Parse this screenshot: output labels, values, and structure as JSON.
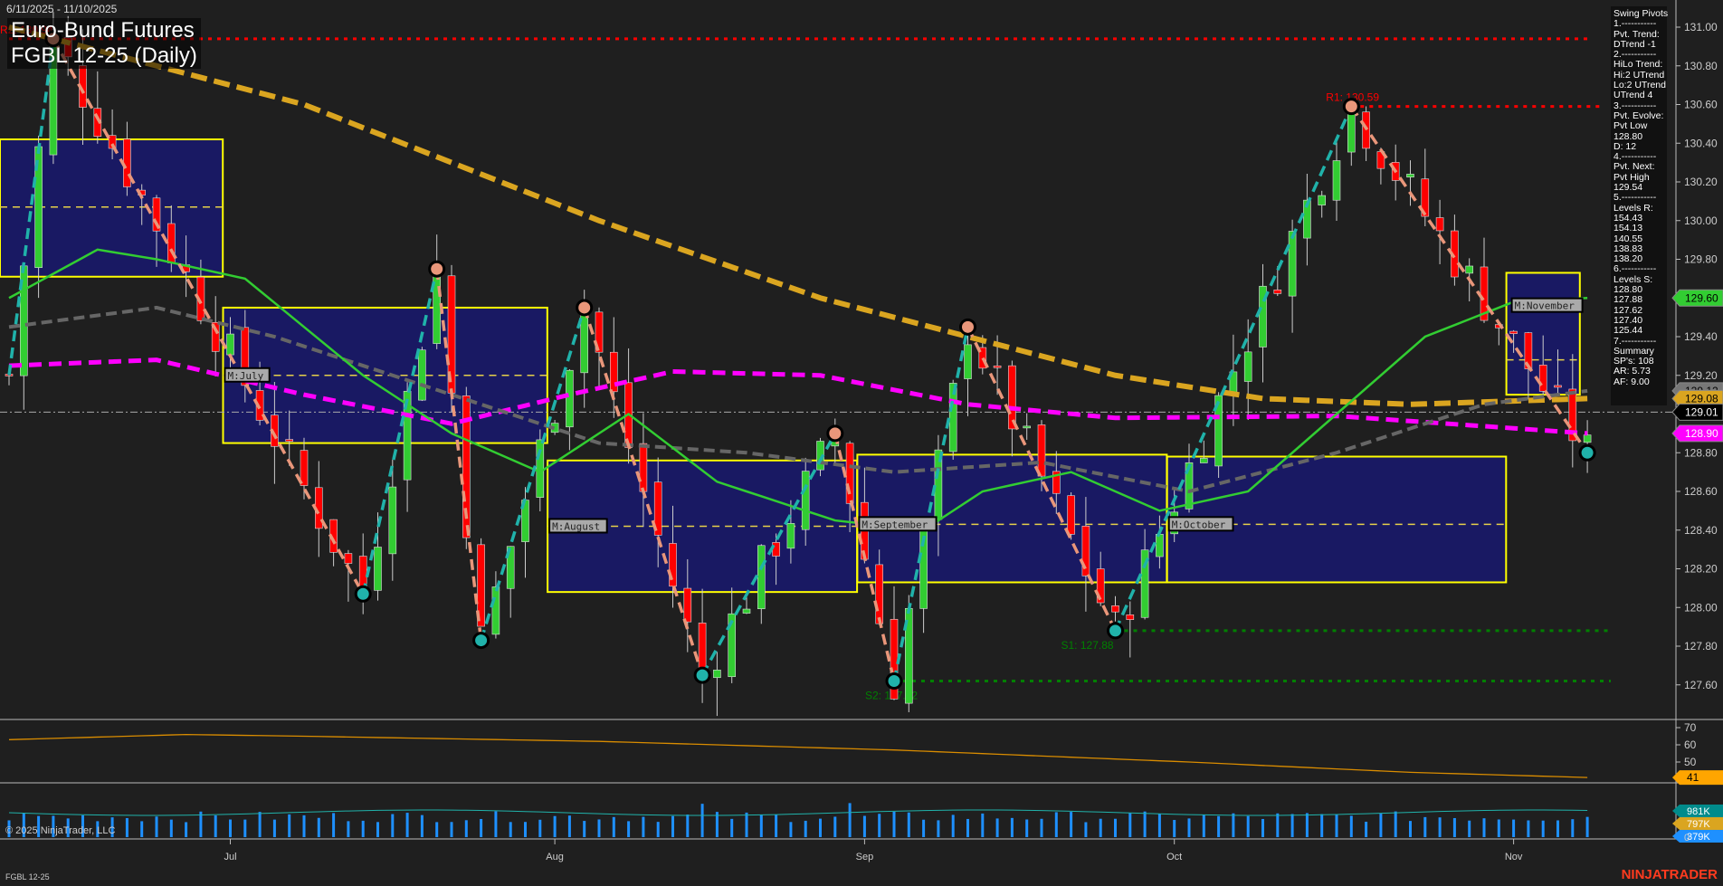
{
  "header": {
    "date_range": "6/11/2025 - 11/10/2025",
    "title_line1": "Euro-Bund Futures",
    "title_line2": "FGBL 12-25 (Daily)"
  },
  "info_panel": {
    "lines": [
      "Swing Pivots",
      "1.-----------",
      "Pvt. Trend:",
      "DTrend -1",
      "2.-----------",
      "HiLo Trend:",
      "Hi:2 UTrend",
      "Lo:2 UTrend",
      "UTrend 4",
      "3.-----------",
      "Pvt. Evolve:",
      "Pvt Low",
      "128.80",
      "D: 12",
      "4.-----------",
      "Pvt. Next:",
      "Pvt High",
      "129.54",
      "5.-----------",
      "Levels R:",
      "154.43",
      "154.13",
      "140.55",
      "138.83",
      "138.20",
      "6.-----------",
      "Levels S:",
      "128.80",
      "127.88",
      "127.62",
      "127.40",
      "125.44",
      "7.-----------",
      "Summary",
      "SP's: 108",
      "AR: 5.73",
      "AF: 9.00"
    ]
  },
  "footer": {
    "copyright": "© 2025 NinjaTrader, LLC",
    "symbol": "FGBL 12-25",
    "brand": "NINJATRADER"
  },
  "colors": {
    "bg": "#1f1f1f",
    "up": "#32cd32",
    "down": "#ff0000",
    "ma_orange": "#daa520",
    "ma_magenta": "#ff00ff",
    "ma_gray": "#666666",
    "ma_green": "#32cd32",
    "swing_up": "#20b2aa",
    "swing_down": "#e9967a",
    "box_fill": "#191970",
    "box_edge": "#ffff00",
    "volume": "#1e90ff"
  },
  "chart_data": {
    "type": "candlestick",
    "title": "FGBL 12-25 (Daily)",
    "bars": 108,
    "ylim": [
      127.45,
      131.12
    ],
    "y_ticks": [
      "131.00",
      "130.80",
      "130.60",
      "130.40",
      "130.20",
      "130.00",
      "129.80",
      "129.40",
      "129.20",
      "128.80",
      "128.60",
      "128.40",
      "128.20",
      "128.00",
      "127.80",
      "127.60"
    ],
    "x_ticks": [
      {
        "label": "Jul",
        "bar": 15
      },
      {
        "label": "Aug",
        "bar": 37
      },
      {
        "label": "Sep",
        "bar": 58
      },
      {
        "label": "Oct",
        "bar": 79
      },
      {
        "label": "Nov",
        "bar": 102
      }
    ],
    "swing_pivots": [
      [
        0,
        129.2
      ],
      [
        3,
        130.94
      ],
      [
        24,
        128.07
      ],
      [
        29,
        129.75
      ],
      [
        32,
        127.83
      ],
      [
        39,
        129.55
      ],
      [
        47,
        127.65
      ],
      [
        56,
        128.9
      ],
      [
        60,
        127.62
      ],
      [
        65,
        129.45
      ],
      [
        75,
        127.88
      ],
      [
        91,
        130.59
      ],
      [
        107,
        128.8
      ]
    ],
    "levels": [
      {
        "label": "R2: 130.94",
        "value": 130.94,
        "from_bar": 0,
        "color": "#ff0000"
      },
      {
        "label": "R1: 130.59",
        "value": 130.59,
        "from_bar": 91,
        "color": "#ff0000"
      },
      {
        "label": "S1: 127.88",
        "value": 127.88,
        "from_bar": 75,
        "color": "#008000"
      },
      {
        "label": "S2: 127.62",
        "value": 127.62,
        "from_bar": 60,
        "color": "#008000"
      }
    ],
    "last_price": 129.01,
    "moving_averages": [
      {
        "name": "orange",
        "points": [
          [
            0,
            131.0
          ],
          [
            20,
            130.6
          ],
          [
            40,
            130.0
          ],
          [
            55,
            129.6
          ],
          [
            65,
            129.4
          ],
          [
            75,
            129.2
          ],
          [
            85,
            129.08
          ],
          [
            95,
            129.05
          ],
          [
            107,
            129.08
          ]
        ]
      },
      {
        "name": "magenta",
        "points": [
          [
            0,
            129.25
          ],
          [
            10,
            129.28
          ],
          [
            20,
            129.1
          ],
          [
            30,
            128.95
          ],
          [
            38,
            129.1
          ],
          [
            45,
            129.22
          ],
          [
            55,
            129.2
          ],
          [
            65,
            129.05
          ],
          [
            75,
            128.98
          ],
          [
            90,
            128.99
          ],
          [
            107,
            128.9
          ]
        ]
      },
      {
        "name": "gray",
        "points": [
          [
            0,
            129.45
          ],
          [
            10,
            129.55
          ],
          [
            18,
            129.4
          ],
          [
            30,
            129.1
          ],
          [
            40,
            128.85
          ],
          [
            50,
            128.8
          ],
          [
            60,
            128.7
          ],
          [
            70,
            128.75
          ],
          [
            80,
            128.6
          ],
          [
            90,
            128.8
          ],
          [
            100,
            129.05
          ],
          [
            107,
            129.12
          ]
        ]
      },
      {
        "name": "green",
        "points": [
          [
            0,
            129.6
          ],
          [
            6,
            129.85
          ],
          [
            10,
            129.8
          ],
          [
            16,
            129.7
          ],
          [
            24,
            129.2
          ],
          [
            30,
            128.9
          ],
          [
            36,
            128.7
          ],
          [
            42,
            129.0
          ],
          [
            48,
            128.65
          ],
          [
            56,
            128.45
          ],
          [
            62,
            128.4
          ],
          [
            66,
            128.6
          ],
          [
            72,
            128.7
          ],
          [
            78,
            128.5
          ],
          [
            84,
            128.6
          ],
          [
            90,
            129.0
          ],
          [
            96,
            129.4
          ],
          [
            102,
            129.58
          ],
          [
            107,
            129.6
          ]
        ]
      }
    ],
    "monthly_boxes": [
      {
        "label": "",
        "from_bar": 0,
        "to_bar": 14,
        "high": 130.42,
        "low": 129.71,
        "mid": 130.07
      },
      {
        "label": "M:July",
        "from_bar": 15,
        "to_bar": 36,
        "high": 129.55,
        "low": 128.85,
        "mid": 129.2
      },
      {
        "label": "M:August",
        "from_bar": 37,
        "to_bar": 57,
        "high": 128.76,
        "low": 128.08,
        "mid": 128.42
      },
      {
        "label": "M:September",
        "from_bar": 58,
        "to_bar": 78,
        "high": 128.79,
        "low": 128.13,
        "mid": 128.43
      },
      {
        "label": "M:October",
        "from_bar": 79,
        "to_bar": 101,
        "high": 128.78,
        "low": 128.13,
        "mid": 128.43
      },
      {
        "label": "M:November",
        "from_bar": 102,
        "to_bar": 106,
        "high": 129.73,
        "low": 129.1,
        "mid": 129.28
      }
    ],
    "price_markers": [
      {
        "value": "129.60",
        "bg": "#32cd32",
        "fg": "#000"
      },
      {
        "value": "129.12",
        "bg": "#777777",
        "fg": "#000"
      },
      {
        "value": "129.08",
        "bg": "#daa520",
        "fg": "#000"
      },
      {
        "value": "129.01",
        "bg": "#000000",
        "fg": "#fff"
      },
      {
        "value": "128.90",
        "bg": "#ff00ff",
        "fg": "#fff"
      }
    ],
    "oscillator": {
      "ticks": [
        "70",
        "60",
        "50"
      ],
      "points": [
        [
          0,
          63
        ],
        [
          12,
          66
        ],
        [
          20,
          65
        ],
        [
          40,
          62
        ],
        [
          60,
          57
        ],
        [
          80,
          50
        ],
        [
          95,
          44
        ],
        [
          107,
          41
        ]
      ],
      "last": "41"
    },
    "volume": {
      "ticks": [
        "0"
      ],
      "markers": [
        "981K",
        "797K",
        "379K"
      ]
    }
  }
}
